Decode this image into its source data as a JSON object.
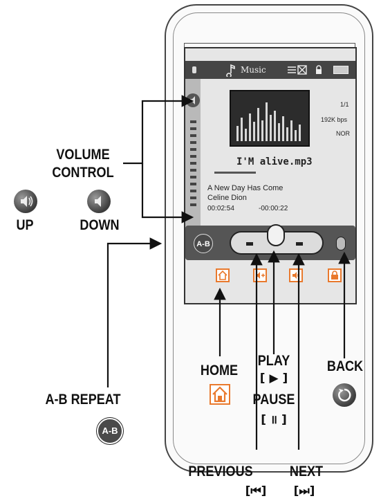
{
  "labels": {
    "volume_line1": "VOLUME",
    "volume_line2": "CONTROL",
    "up": "UP",
    "down": "DOWN",
    "home": "HOME",
    "play": "PLAY",
    "play_symbol": "[ ▶ ]",
    "pause": "PAUSE",
    "pause_symbol": "[ ॥ ]",
    "back": "BACK",
    "ab_repeat": "A-B REPEAT",
    "previous": "PREVIOUS",
    "previous_symbol": "[⏮]",
    "next": "NEXT",
    "next_symbol": "[⏭]",
    "ab_badge": "A-B"
  },
  "screen": {
    "app_title": "Music",
    "track_count": "1/1",
    "bitrate": "192K bps",
    "eq_mode": "NOR",
    "file_name": "I'M alive.mp3",
    "song_title": "A New Day Has Come",
    "artist": "Celine Dion",
    "elapsed": "00:02:54",
    "remaining": "-00:00:22"
  },
  "icons": {
    "home": "home-icon",
    "volume_up": "volume-up-icon",
    "volume_down": "volume-down-icon",
    "lock": "lock-icon",
    "back": "back-icon"
  },
  "colors": {
    "accent_orange": "#e9792d",
    "screen_dark": "#454545"
  }
}
